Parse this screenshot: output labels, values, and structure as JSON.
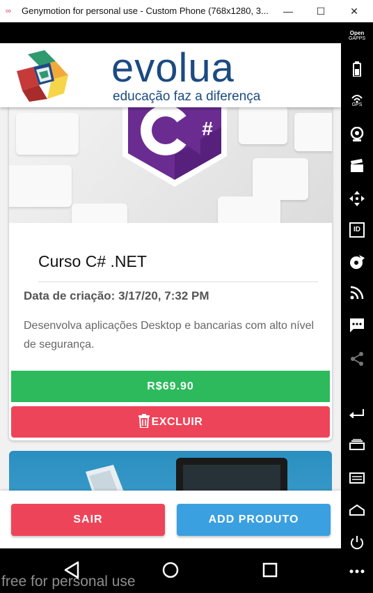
{
  "window": {
    "title": "Genymotion for personal use - Custom Phone (768x1280, 3...",
    "minimize": "—",
    "maximize": "☐",
    "close": "✕"
  },
  "brand": {
    "name": "evolua",
    "tagline": "educação faz a diferença"
  },
  "course": {
    "title": "Curso C# .NET",
    "created_label": "Data de criação:",
    "created_value": "3/17/20, 7:32 PM",
    "description": "Desenvolva aplicações Desktop e bancarias com alto nível de segurança.",
    "price": "R$69.90",
    "delete_label": "EXCLUIR",
    "logo_symbol": "#"
  },
  "bottom": {
    "exit_label": "SAIR",
    "add_label": "ADD PRODUTO"
  },
  "sidebar": {
    "opengapps_top": "Open",
    "opengapps_bottom": "GAPPS",
    "gps_label": "GPS",
    "id_label": "ID"
  },
  "watermark": "free for personal use",
  "colors": {
    "primary_blue": "#1c4a82",
    "price_green": "#2cba5c",
    "danger_red": "#ee4459",
    "add_blue": "#3aa0e0",
    "csharp_purple": "#6a2c91"
  }
}
